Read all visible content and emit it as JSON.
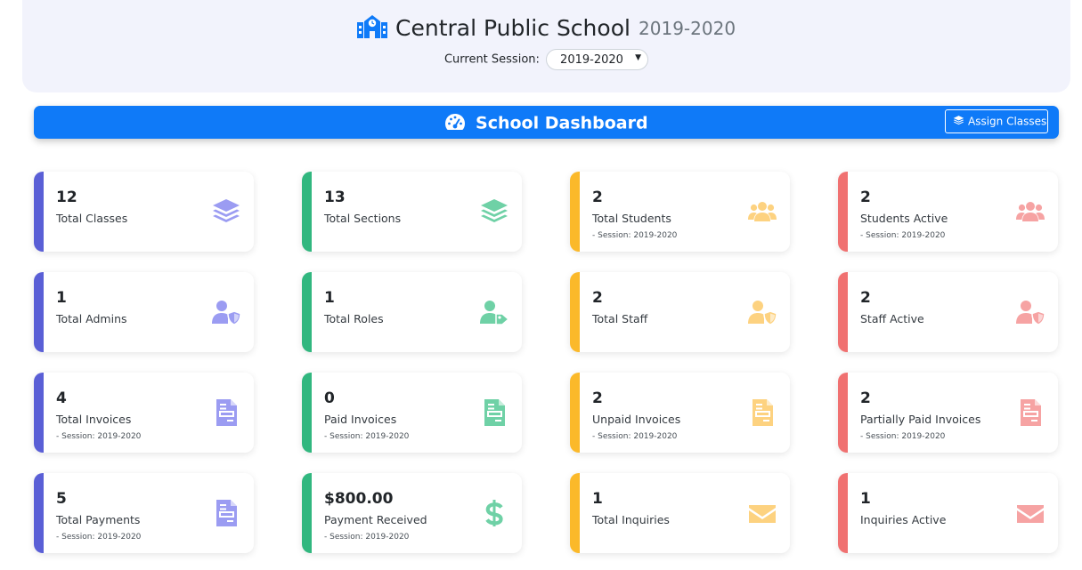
{
  "header": {
    "school_name": "Central Public School",
    "school_year": "2019-2020",
    "session_label": "Current Session:",
    "session_value": "2019-2020"
  },
  "dashboard": {
    "title": "School Dashboard",
    "assign_label": "Assign Classes",
    "accent_color": "#0f7af8"
  },
  "colors": {
    "indigo": "#5a5fd6",
    "green": "#31b77f",
    "yellow": "#fbb92a",
    "red": "#f07171"
  },
  "cards": [
    {
      "value": "12",
      "label": "Total Classes",
      "sub": "",
      "icon": "layers-icon"
    },
    {
      "value": "13",
      "label": "Total Sections",
      "sub": "",
      "icon": "layers-icon"
    },
    {
      "value": "2",
      "label": "Total Students",
      "sub": "- Session: 2019-2020",
      "icon": "users-icon"
    },
    {
      "value": "2",
      "label": "Students Active",
      "sub": "- Session: 2019-2020",
      "icon": "users-icon"
    },
    {
      "value": "1",
      "label": "Total Admins",
      "sub": "",
      "icon": "user-shield-icon"
    },
    {
      "value": "1",
      "label": "Total Roles",
      "sub": "",
      "icon": "user-tag-icon"
    },
    {
      "value": "2",
      "label": "Total Staff",
      "sub": "",
      "icon": "user-shield-icon"
    },
    {
      "value": "2",
      "label": "Staff Active",
      "sub": "",
      "icon": "user-shield-icon"
    },
    {
      "value": "4",
      "label": "Total Invoices",
      "sub": "- Session: 2019-2020",
      "icon": "invoice-icon"
    },
    {
      "value": "0",
      "label": "Paid Invoices",
      "sub": "- Session: 2019-2020",
      "icon": "invoice-icon"
    },
    {
      "value": "2",
      "label": "Unpaid Invoices",
      "sub": "- Session: 2019-2020",
      "icon": "invoice-icon"
    },
    {
      "value": "2",
      "label": "Partially Paid Invoices",
      "sub": "- Session: 2019-2020",
      "icon": "invoice-icon"
    },
    {
      "value": "5",
      "label": "Total Payments",
      "sub": "- Session: 2019-2020",
      "icon": "invoice-icon"
    },
    {
      "value": "$800.00",
      "label": "Payment Received",
      "sub": "- Session: 2019-2020",
      "icon": "dollar-icon"
    },
    {
      "value": "1",
      "label": "Total Inquiries",
      "sub": "",
      "icon": "envelope-icon"
    },
    {
      "value": "1",
      "label": "Inquiries Active",
      "sub": "",
      "icon": "envelope-icon"
    }
  ]
}
